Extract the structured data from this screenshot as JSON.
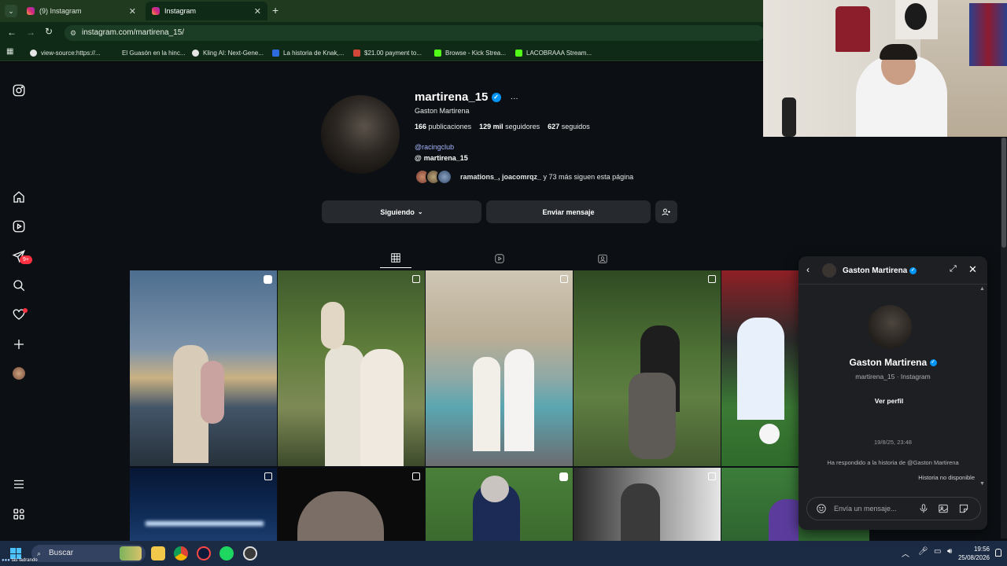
{
  "browser": {
    "tabs": [
      {
        "title": "(9) Instagram",
        "active": false
      },
      {
        "title": "Instagram",
        "active": true
      }
    ],
    "new_tab": "+",
    "url": "instagram.com/martirena_15/",
    "bookmarks": [
      "view-source:https://...",
      "El Guasón en la hinc...",
      "Kling AI: Next-Gene...",
      "La historia de Knak,...",
      "$21.00 payment to...",
      "Browse - Kick Strea...",
      "LACOBRAAA Stream..."
    ]
  },
  "sidenav": {
    "notifications_badge": "9+"
  },
  "profile": {
    "username": "martirena_15",
    "verified_mark": "✓",
    "more": "···",
    "full_name": "Gaston Martirena",
    "posts_count": "166",
    "posts_label": "publicaciones",
    "followers_count": "129 mil",
    "followers_label": "seguidores",
    "following_count": "627",
    "following_label": "seguidos",
    "bio_link": "@racingclub",
    "threads_handle": "martirena_15",
    "followed_by_names": "ramations_, joacomrqz_",
    "followed_by_rest": " y 73 más siguen esta página",
    "following_button": "Siguiendo",
    "message_button": "Enviar mensaje"
  },
  "chat": {
    "title": "Gaston Martirena",
    "name": "Gaston Martirena",
    "subtitle": "martirena_15 · Instagram",
    "view_profile": "Ver perfil",
    "date": "19/8/25, 23:48",
    "replied_text": "Ha respondido a la historia de @Gaston Martirena",
    "story_unavailable": "Historia no disponible",
    "input_placeholder": "Envía un mensaje..."
  },
  "taskbar": {
    "search_placeholder": "Buscar",
    "time": "19:56",
    "date": "25/08/2026",
    "notify_text": "tas ladrando"
  },
  "colors": {
    "page_bg": "#0c1014",
    "accent_blue": "#0095f6",
    "browser_green": "#0f2b18",
    "taskbar": "#1c2b44",
    "badge_red": "#ff3040"
  }
}
